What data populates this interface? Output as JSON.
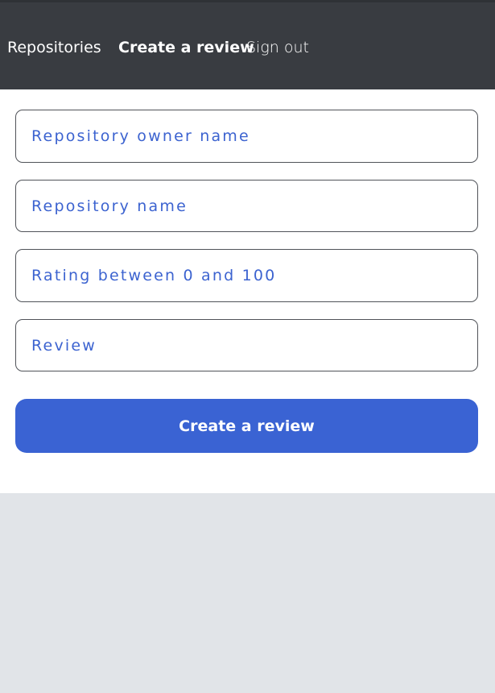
{
  "nav": {
    "repositories_label": "Repositories",
    "create_review_label": "Create a review",
    "sign_out_label": "Sign out"
  },
  "form": {
    "owner_placeholder": "Repository owner name",
    "owner_value": "",
    "repo_placeholder": "Repository name",
    "repo_value": "",
    "rating_placeholder": "Rating between 0 and 100",
    "rating_value": "",
    "review_placeholder": "Review",
    "review_value": "",
    "submit_label": "Create a review"
  },
  "colors": {
    "appbar": "#393c41",
    "accent": "#3a63d3",
    "page_background": "#e1e4e8"
  }
}
